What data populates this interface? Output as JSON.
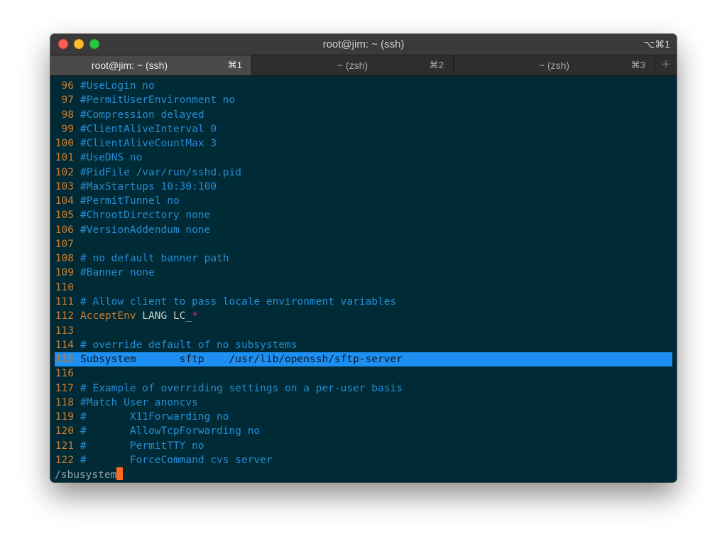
{
  "window": {
    "title": "root@jim: ~ (ssh)",
    "shortcut": "⌥⌘1"
  },
  "tabs": [
    {
      "label": "root@jim: ~ (ssh)",
      "key": "⌘1",
      "active": true
    },
    {
      "label": "~ (zsh)",
      "key": "⌘2",
      "active": false
    },
    {
      "label": "~ (zsh)",
      "key": "⌘3",
      "active": false
    }
  ],
  "new_tab_label": "+",
  "lines": [
    {
      "n": "96",
      "code": "#UseLogin no"
    },
    {
      "n": "97",
      "code": "#PermitUserEnvironment no"
    },
    {
      "n": "98",
      "code": "#Compression delayed"
    },
    {
      "n": "99",
      "code": "#ClientAliveInterval 0"
    },
    {
      "n": "100",
      "code": "#ClientAliveCountMax 3"
    },
    {
      "n": "101",
      "code": "#UseDNS no"
    },
    {
      "n": "102",
      "code": "#PidFile /var/run/sshd.pid"
    },
    {
      "n": "103",
      "code": "#MaxStartups 10:30:100"
    },
    {
      "n": "104",
      "code": "#PermitTunnel no"
    },
    {
      "n": "105",
      "code": "#ChrootDirectory none"
    },
    {
      "n": "106",
      "code": "#VersionAddendum none"
    },
    {
      "n": "107",
      "code": ""
    },
    {
      "n": "108",
      "code": "# no default banner path"
    },
    {
      "n": "109",
      "code": "#Banner none"
    },
    {
      "n": "110",
      "code": ""
    },
    {
      "n": "111",
      "code": "# Allow client to pass locale environment variables"
    },
    {
      "n": "112",
      "keyword": "AcceptEnv",
      "plain": " LANG LC_",
      "star": "*"
    },
    {
      "n": "113",
      "code": ""
    },
    {
      "n": "114",
      "code": "# override default of no subsystems"
    },
    {
      "n": "115",
      "code": "Subsystem       sftp    /usr/lib/openssh/sftp-server",
      "highlight": true
    },
    {
      "n": "116",
      "code": ""
    },
    {
      "n": "117",
      "code": "# Example of overriding settings on a per-user basis"
    },
    {
      "n": "118",
      "code": "#Match User anoncvs"
    },
    {
      "n": "119",
      "code": "#       X11Forwarding no"
    },
    {
      "n": "120",
      "code": "#       AllowTcpForwarding no"
    },
    {
      "n": "121",
      "code": "#       PermitTTY no"
    },
    {
      "n": "122",
      "code": "#       ForceCommand cvs server"
    }
  ],
  "command_line": "/sbusystem",
  "colors": {
    "background": "#002b36",
    "line_number": "#cb7d31",
    "comment": "#268bd2",
    "highlight": "#1e8ff3",
    "cursor": "#ff6a1c"
  }
}
